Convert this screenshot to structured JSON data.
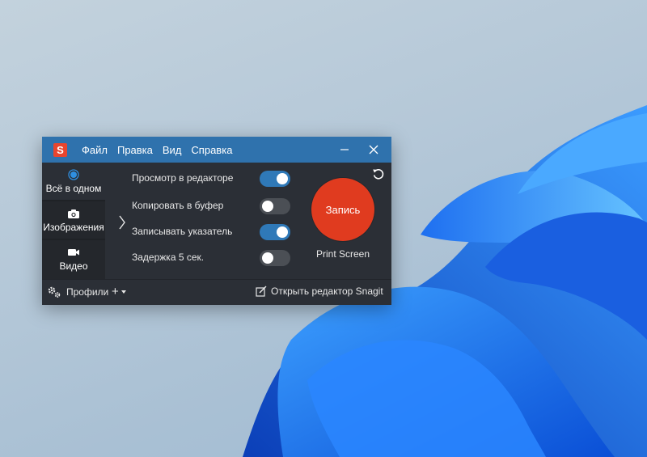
{
  "colors": {
    "titlebar": "#2f72ad",
    "window_bg": "#2b2f36",
    "sidebar_bg": "#24272c",
    "toggle_on": "#2f79b8",
    "toggle_off": "#4b4f55",
    "record": "#e03b1f",
    "logo": "#e8452e"
  },
  "app": {
    "logo_letter": "S",
    "logo_icon": "snagit-logo-icon"
  },
  "menu": [
    "Файл",
    "Правка",
    "Вид",
    "Справка"
  ],
  "window_controls": {
    "minimize_icon": "minimize-icon",
    "close_icon": "close-icon"
  },
  "modes": [
    {
      "label": "Всё в одном",
      "icon": "all-in-one-radio-icon",
      "active": true
    },
    {
      "label": "Изображения",
      "icon": "camera-icon",
      "active": false
    },
    {
      "label": "Видео",
      "icon": "video-camera-icon",
      "active": false
    }
  ],
  "options": [
    {
      "label": "Просмотр в редакторе",
      "on": true
    },
    {
      "label": "Копировать в буфер",
      "on": false
    },
    {
      "label": "Записывать указатель",
      "on": true
    },
    {
      "label": "Задержка 5 сек.",
      "on": false
    }
  ],
  "record": {
    "label": "Запись",
    "hotkey": "Print Screen"
  },
  "footer": {
    "profiles_label": "Профили",
    "add_label": "+",
    "open_editor_label": "Открыть редактор Snagit"
  }
}
